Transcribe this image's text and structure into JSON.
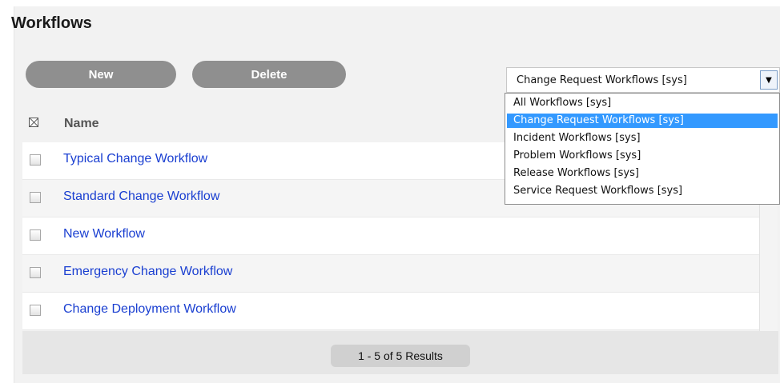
{
  "header": {
    "title": "Workflows"
  },
  "toolbar": {
    "new_label": "New",
    "delete_label": "Delete"
  },
  "filter": {
    "selected": "Change Request Workflows [sys]",
    "options": [
      "All Workflows [sys]",
      "Change Request Workflows [sys]",
      "Incident Workflows [sys]",
      "Problem Workflows [sys]",
      "Release Workflows [sys]",
      "Service Request Workflows [sys]"
    ]
  },
  "table": {
    "column_name": "Name",
    "rows": [
      "Typical Change Workflow",
      "Standard Change Workflow",
      "New Workflow",
      "Emergency Change Workflow",
      "Change Deployment Workflow"
    ]
  },
  "pagination": {
    "results": "1 - 5 of 5 Results"
  },
  "colors": {
    "link": "#1a3fd1",
    "button": "#8f8f8f",
    "selection": "#3399ff"
  },
  "icons": {
    "header_checkbox": "checkbox-select-all-icon",
    "dropdown_arrow": "chevron-down-icon"
  }
}
